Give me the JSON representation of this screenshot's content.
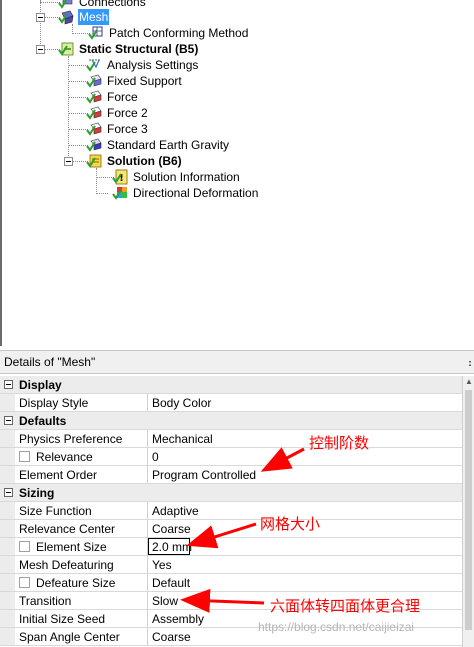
{
  "tree": {
    "items": [
      {
        "label": "Connections"
      },
      {
        "label": "Mesh"
      },
      {
        "label": "Patch Conforming Method"
      },
      {
        "label": "Static Structural (B5)"
      },
      {
        "label": "Analysis Settings"
      },
      {
        "label": "Fixed Support"
      },
      {
        "label": "Force"
      },
      {
        "label": "Force 2"
      },
      {
        "label": "Force 3"
      },
      {
        "label": "Standard Earth Gravity"
      },
      {
        "label": "Solution (B6)"
      },
      {
        "label": "Solution Information"
      },
      {
        "label": "Directional Deformation"
      }
    ]
  },
  "details": {
    "title": "Details of \"Mesh\"",
    "pin": "։",
    "categories": {
      "display": "Display",
      "defaults": "Defaults",
      "sizing": "Sizing"
    },
    "rows": [
      {
        "name": "Display Style",
        "value": "Body Color"
      },
      {
        "name": "Physics Preference",
        "value": "Mechanical"
      },
      {
        "name": "Relevance",
        "value": "0"
      },
      {
        "name": "Element Order",
        "value": "Program Controlled"
      },
      {
        "name": "Size Function",
        "value": "Adaptive"
      },
      {
        "name": "Relevance Center",
        "value": "Coarse"
      },
      {
        "name": "Element Size",
        "value": "2.0 mm"
      },
      {
        "name": "Mesh Defeaturing",
        "value": "Yes"
      },
      {
        "name": "Defeature Size",
        "value": "Default"
      },
      {
        "name": "Transition",
        "value": "Slow"
      },
      {
        "name": "Initial Size Seed",
        "value": "Assembly"
      },
      {
        "name": "Span Angle Center",
        "value": "Coarse"
      }
    ]
  },
  "annotations": {
    "element_order_note": "控制阶数",
    "element_size_note": "网格大小",
    "transition_note": "六面体转四面体更合理"
  },
  "watermark": "https://blog.csdn.net/caijieizai",
  "colors": {
    "selection": "#3399ff",
    "annotation": "#ff0000",
    "check": "#2e9e2e"
  }
}
